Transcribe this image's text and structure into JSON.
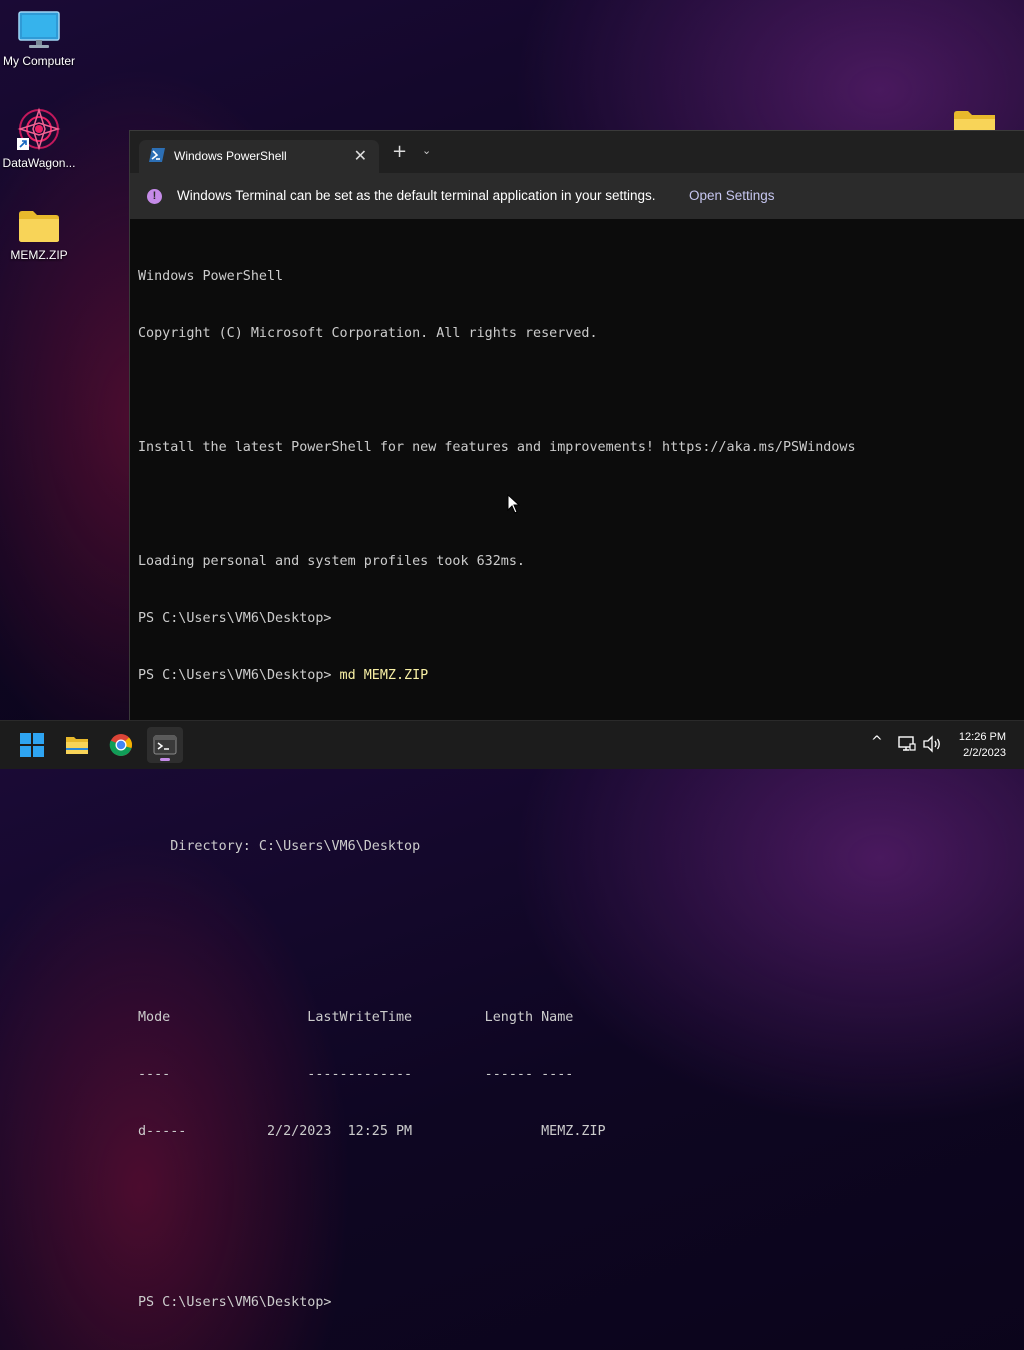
{
  "desktop": {
    "icons": [
      {
        "label": "My Computer",
        "icon": "monitor-icon"
      },
      {
        "label": "DataWagon...",
        "icon": "datawagon-app-icon"
      },
      {
        "label": "MEMZ.ZIP",
        "icon": "folder-icon"
      }
    ]
  },
  "window": {
    "tab_title": "Windows PowerShell",
    "tab_icon": "powershell-icon",
    "close_symbol": "✕",
    "new_tab_symbol": "+",
    "dropdown_symbol": "⌄",
    "infobar": {
      "icon_symbol": "!",
      "message": "Windows Terminal can be set as the default terminal application in your settings.",
      "link": "Open Settings"
    },
    "console": {
      "lines": [
        "Windows PowerShell",
        "Copyright (C) Microsoft Corporation. All rights reserved.",
        "",
        "Install the latest PowerShell for new features and improvements! https://aka.ms/PSWindows",
        "",
        "Loading personal and system profiles took 632ms.",
        "PS C:\\Users\\VM6\\Desktop>",
        "PS C:\\Users\\VM6\\Desktop> ",
        "",
        "",
        "    Directory: C:\\Users\\VM6\\Desktop",
        "",
        "",
        "Mode                 LastWriteTime         Length Name",
        "----                 -------------         ------ ----",
        "d-----          2/2/2023  12:25 PM                MEMZ.ZIP",
        "",
        "",
        "PS C:\\Users\\VM6\\Desktop>"
      ],
      "command": "md MEMZ.ZIP"
    }
  },
  "taskbar": {
    "apps": [
      {
        "name": "start-button",
        "icon": "windows-logo-icon"
      },
      {
        "name": "file-explorer",
        "icon": "folder-icon"
      },
      {
        "name": "chrome",
        "icon": "chrome-icon"
      },
      {
        "name": "terminal",
        "icon": "terminal-icon",
        "active": true
      }
    ],
    "tray": {
      "chevron_symbol": "^",
      "time": "12:26 PM",
      "date": "2/2/2023"
    }
  },
  "colors": {
    "accent": "#c58be8",
    "terminal_bg": "#0c0c0c",
    "command_text": "#f9f1a5"
  }
}
